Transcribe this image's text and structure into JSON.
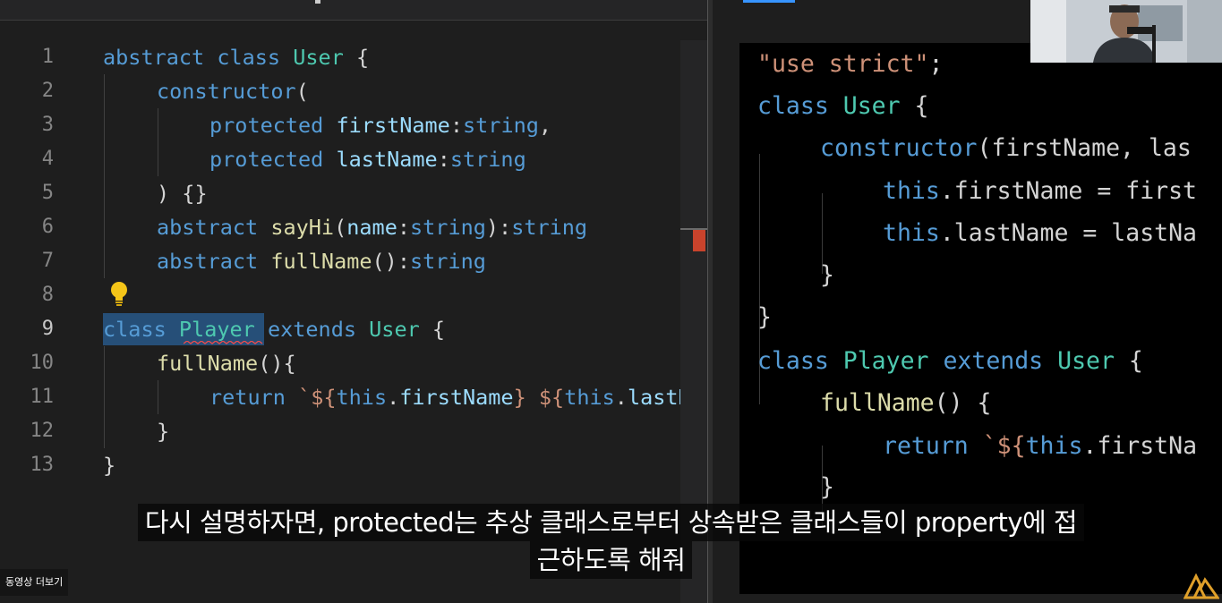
{
  "editor_left": {
    "line_numbers": [
      "1",
      "2",
      "3",
      "4",
      "5",
      "6",
      "7",
      "8",
      "9",
      "10",
      "11",
      "12",
      "13"
    ],
    "active_line": "9",
    "code": {
      "l1": {
        "kw1": "abstract",
        "kw2": "class",
        "name": "User",
        "brace": "{"
      },
      "l2": {
        "ctor": "constructor",
        "paren": "("
      },
      "l3": {
        "mod": "protected",
        "prop": "firstName",
        "colon": ":",
        "type": "string",
        "comma": ","
      },
      "l4": {
        "mod": "protected",
        "prop": "lastName",
        "colon": ":",
        "type": "string"
      },
      "l5": {
        "text": ") {}"
      },
      "l6": {
        "kw": "abstract",
        "fn": "sayHi",
        "open": "(",
        "param": "name",
        "colon": ":",
        "type": "string",
        "close": "):",
        "ret": "string"
      },
      "l7": {
        "kw": "abstract",
        "fn": "fullName",
        "parens": "():",
        "ret": "string"
      },
      "l9": {
        "kw": "class",
        "name": "Player",
        "ext": "extends",
        "parent": "User",
        "brace": "{"
      },
      "l10": {
        "fn": "fullName",
        "rest": "(){"
      },
      "l11": {
        "ret": "return",
        "tick": "`${",
        "this1": "this",
        "dot1": ".",
        "p1": "firstName",
        "mid": "} ${",
        "this2": "this",
        "dot2": ".",
        "p2": "lastN"
      },
      "l12": {
        "text": "}"
      },
      "l13": {
        "text": "}"
      }
    },
    "colors": {
      "background": "#1e1e1e",
      "keyword": "#569cd6",
      "class": "#4ec9b0",
      "function": "#dcdcaa",
      "variable": "#9cdcfe",
      "string": "#ce9178"
    }
  },
  "editor_right": {
    "code": {
      "r1": {
        "str": "\"use strict\"",
        "semi": ";"
      },
      "r2": {
        "kw": "class",
        "name": "User",
        "brace": "{"
      },
      "r3": {
        "fn": "constructor",
        "rest": "(firstName, las"
      },
      "r4": {
        "this": "this",
        "rest": ".firstName = first"
      },
      "r5": {
        "this": "this",
        "rest": ".lastName = lastNa"
      },
      "r6": {
        "text": "}"
      },
      "r7": {
        "text": "}"
      },
      "r8": {
        "kw": "class",
        "name": "Player",
        "ext": "extends",
        "parent": "User",
        "brace": "{"
      },
      "r9": {
        "fn": "fullName",
        "rest": "() {"
      },
      "r10": {
        "ret": "return",
        "tick": "`${",
        "this": "this",
        "rest": ".firstNa"
      },
      "r11": {
        "text": "}"
      }
    }
  },
  "subtitle": {
    "line1": "다시 설명하자면, protected는 추상 클래스로부터 상속받은 클래스들이 property에 접",
    "line2": "근하도록 해줘"
  },
  "overlay": {
    "more_videos": "동영상 더보기",
    "webcam": "webcam-feed",
    "logo_icon": "channel-logo-icon"
  }
}
